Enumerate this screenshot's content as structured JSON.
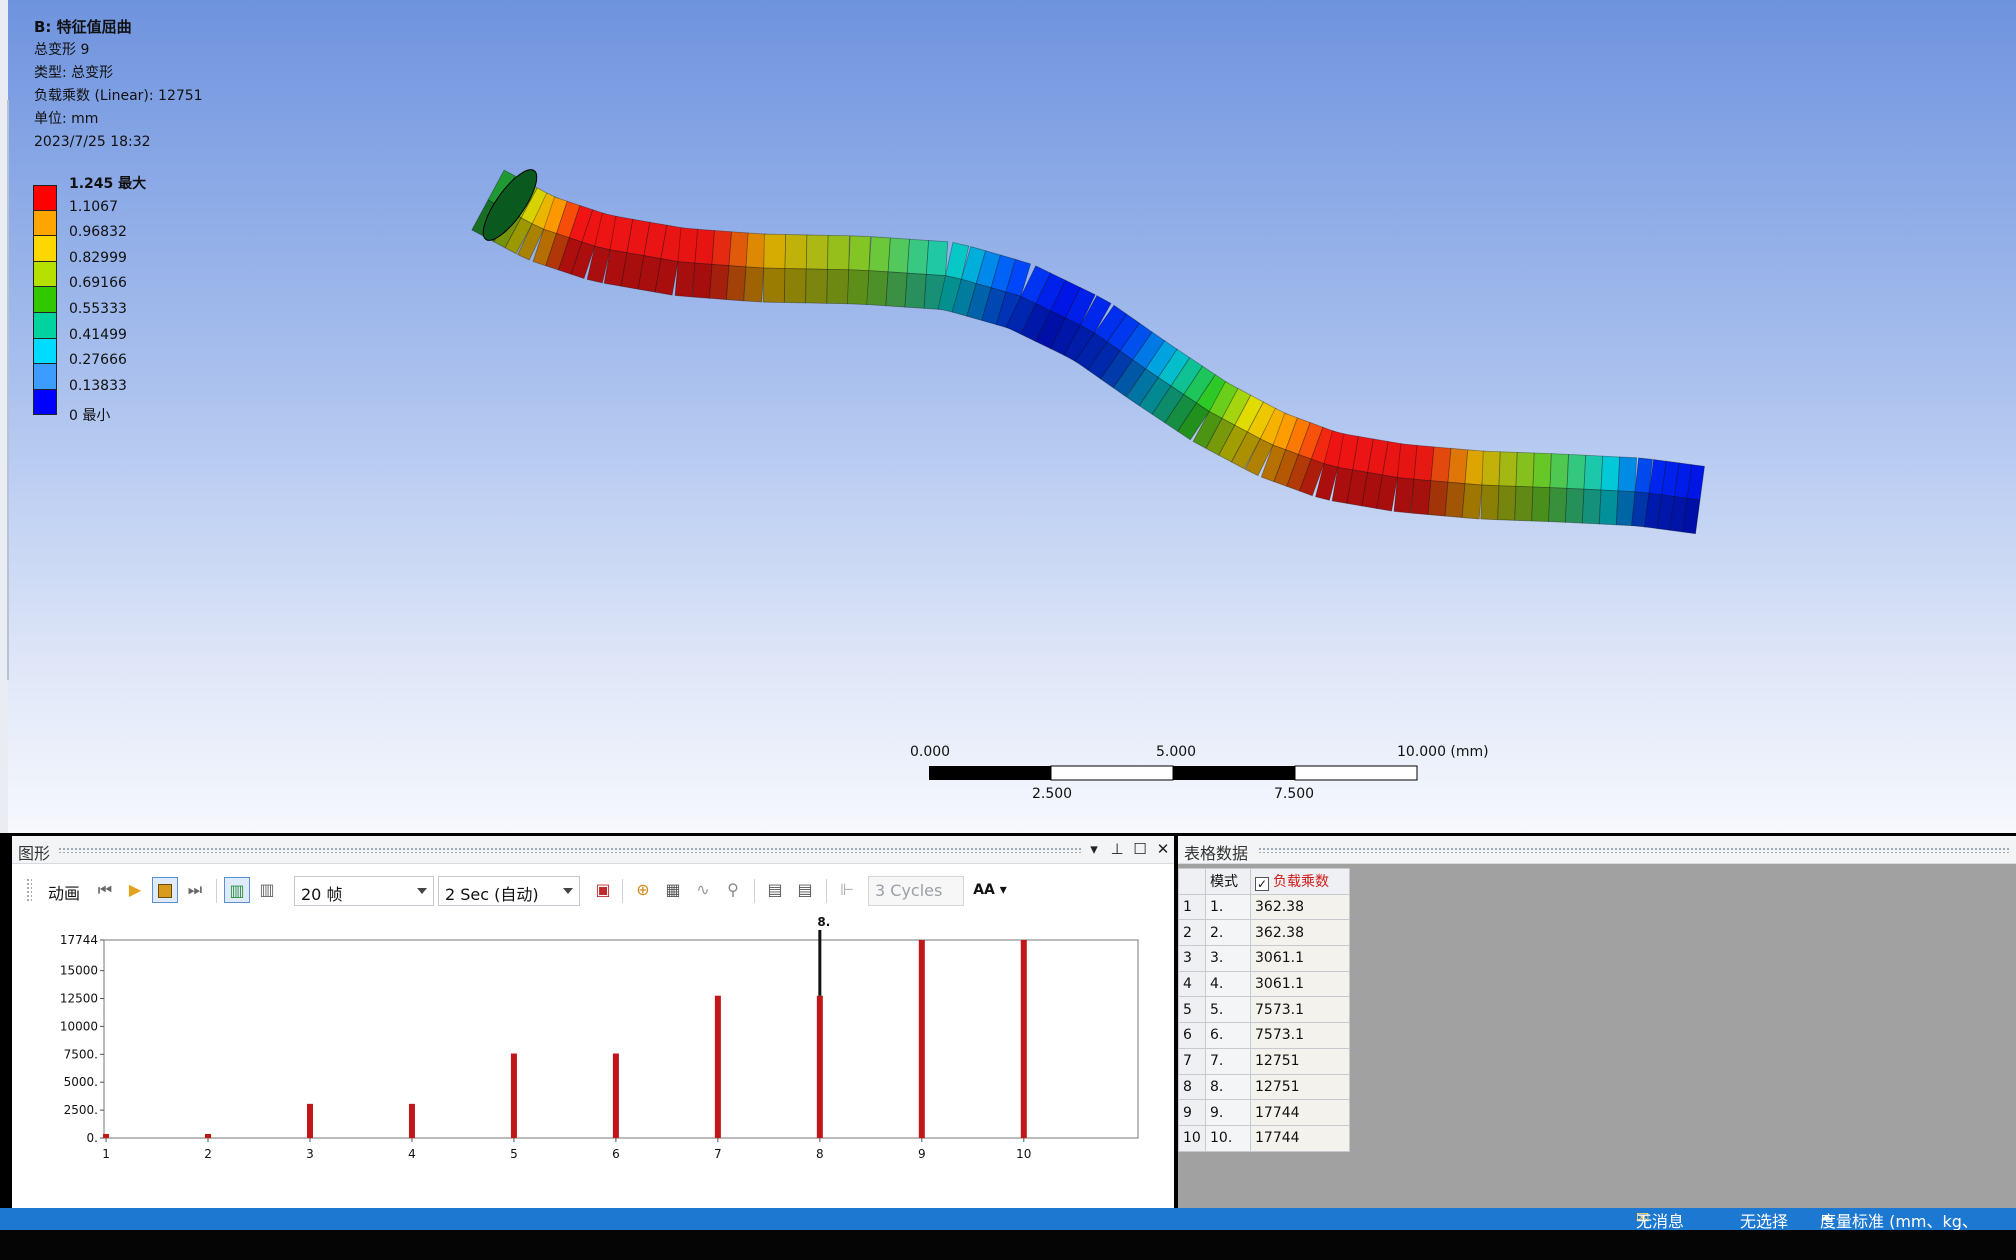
{
  "info": {
    "title": "B: 特征值屈曲",
    "line1": "总变形 9",
    "line2": "类型: 总变形",
    "line3": "负载乘数 (Linear): 12751",
    "line4": "单位: mm",
    "line5": "2023/7/25 18:32"
  },
  "legend": {
    "labels": [
      "1.245 最大",
      "1.1067",
      "0.96832",
      "0.82999",
      "0.69166",
      "0.55333",
      "0.41499",
      "0.27666",
      "0.13833"
    ],
    "min_label": "0 最小",
    "colors": [
      "#ff0000",
      "#ffa500",
      "#ffd700",
      "#b5e000",
      "#32c800",
      "#00d2a0",
      "#00dcff",
      "#3c9cff",
      "#0000ff"
    ]
  },
  "scale_bar": {
    "top_labels": [
      "0.000",
      "5.000",
      "10.000 (mm)"
    ],
    "bottom_labels": [
      "2.500",
      "7.500"
    ]
  },
  "graph_panel": {
    "title": "图形",
    "animation_label": "动画",
    "frames_value": "20 帧",
    "duration_value": "2 Sec (自动)",
    "cycles_value": "3 Cycles",
    "aa_label": "AA"
  },
  "chart_data": {
    "type": "bar",
    "categories": [
      "1",
      "2",
      "3",
      "4",
      "5",
      "6",
      "7",
      "8",
      "9",
      "10"
    ],
    "values": [
      362.38,
      362.38,
      3061.1,
      3061.1,
      7573.1,
      7573.1,
      12751,
      12751,
      17744,
      17744
    ],
    "y_ticks": [
      "0.",
      "2500.",
      "5000.",
      "7500.",
      "10000",
      "12500",
      "15000",
      "17744"
    ],
    "ylim": [
      0,
      17744
    ],
    "selected_index": 8,
    "selected_label": "8.",
    "bar_color": "#c0171b"
  },
  "table_panel": {
    "title": "表格数据",
    "headers": [
      "模式",
      "负载乘数"
    ],
    "rows": [
      {
        "n": "1",
        "mode": "1.",
        "value": "362.38"
      },
      {
        "n": "2",
        "mode": "2.",
        "value": "362.38"
      },
      {
        "n": "3",
        "mode": "3.",
        "value": "3061.1"
      },
      {
        "n": "4",
        "mode": "4.",
        "value": "3061.1"
      },
      {
        "n": "5",
        "mode": "5.",
        "value": "7573.1"
      },
      {
        "n": "6",
        "mode": "6.",
        "value": "7573.1"
      },
      {
        "n": "7",
        "mode": "7.",
        "value": "12751"
      },
      {
        "n": "8",
        "mode": "8.",
        "value": "12751"
      },
      {
        "n": "9",
        "mode": "9.",
        "value": "17744"
      },
      {
        "n": "10",
        "mode": "10.",
        "value": "17744"
      }
    ]
  },
  "status": {
    "messages": "无消息",
    "selection": "无选择",
    "units": "度量标准 (mm、kg、"
  }
}
